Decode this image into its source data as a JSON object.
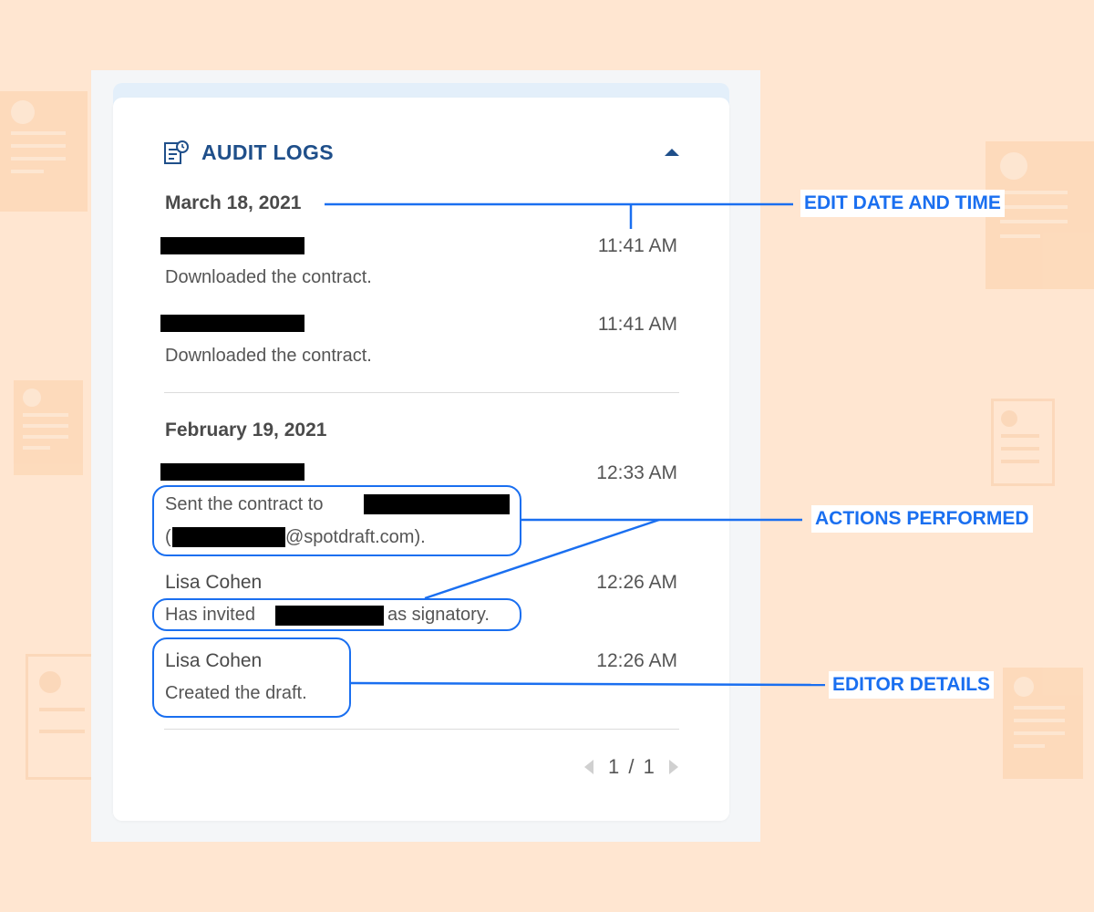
{
  "header": {
    "title": "AUDIT LOGS",
    "icon": "document-clock-icon",
    "collapse_icon": "caret-up-icon"
  },
  "groups": [
    {
      "date": "March 18, 2021",
      "entries": [
        {
          "name": "",
          "time": "11:41 AM",
          "action": "Downloaded the contract."
        },
        {
          "name": "",
          "time": "11:41 AM",
          "action": "Downloaded the contract."
        }
      ]
    },
    {
      "date": "February 19, 2021",
      "entries": [
        {
          "name": "",
          "time": "12:33 AM",
          "action_prefix": "Sent the contract to",
          "action_line2_prefix": "(",
          "action_line2_suffix": "@spotdraft.com)."
        },
        {
          "name": "Lisa Cohen",
          "time": "12:26 AM",
          "action_prefix": "Has invited",
          "action_suffix": "as signatory."
        },
        {
          "name": "Lisa Cohen",
          "time": "12:26 AM",
          "action": "Created the draft."
        }
      ]
    }
  ],
  "pagination": {
    "text": "1 / 1"
  },
  "annotations": {
    "edit_date_time": "EDIT DATE AND TIME",
    "actions_performed": "ACTIONS PERFORMED",
    "editor_details": "EDITOR DETAILS"
  },
  "colors": {
    "background": "#ffe6d1",
    "accent": "#1a6ff0",
    "title": "#1f4f8a"
  }
}
